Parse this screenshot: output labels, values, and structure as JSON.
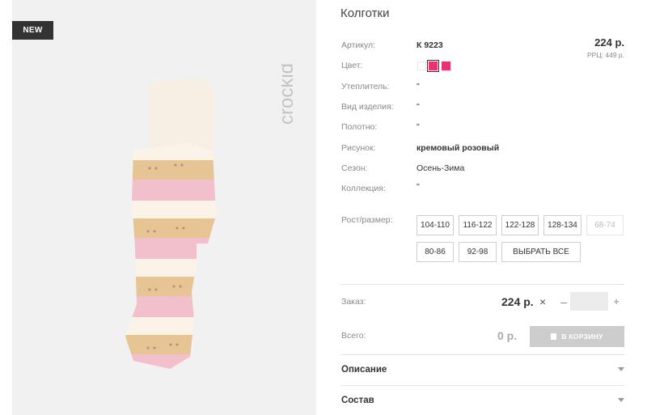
{
  "badge": "NEW",
  "brand": "crockid",
  "title": "Колготки",
  "price": "224 р.",
  "rrp": "РРЦ: 449 р.",
  "properties": [
    {
      "label": "Артикул:",
      "value": "К 9223"
    },
    {
      "label": "Цвет:",
      "value": ""
    },
    {
      "label": "Утеплитель:",
      "value": "\""
    },
    {
      "label": "Вид изделия:",
      "value": "\""
    },
    {
      "label": "Полотно:",
      "value": "\""
    },
    {
      "label": "Рисунок:",
      "value": "кремовый розовый"
    },
    {
      "label": "Сезон:",
      "value": "Осень-Зима"
    },
    {
      "label": "Коллекция:",
      "value": "\""
    }
  ],
  "colors": [
    "#ffffff",
    "#e8336f",
    "#e8336f"
  ],
  "size_label": "Рост/размер:",
  "sizes": [
    "104-110",
    "116-122",
    "122-128",
    "128-134",
    "68-74",
    "80-86",
    "92-98"
  ],
  "select_all": "ВЫБРАТЬ ВСЕ",
  "order": {
    "label": "Заказ:",
    "price": "224 р.",
    "times": "×",
    "minus": "–",
    "plus": "+"
  },
  "total": {
    "label": "Всего:",
    "value": "0 р.",
    "button": "В КОРЗИНУ"
  },
  "accordion": [
    "Описание",
    "Состав"
  ]
}
